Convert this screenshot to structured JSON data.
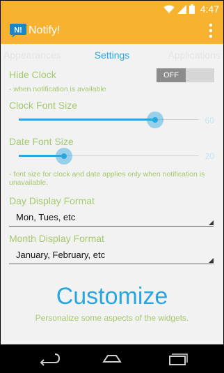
{
  "status_bar": {
    "time": "4:47",
    "wifi_icon": "wifi-icon",
    "signal_icon": "signal-icon",
    "battery_icon": "battery-icon"
  },
  "app_bar": {
    "logo_text": "N!",
    "title": "Notify!",
    "menu_icon": "overflow-menu-icon",
    "color": "#f7b230"
  },
  "tabs": {
    "previous": "Appearances",
    "current": "Settings",
    "next": "Applications"
  },
  "settings": {
    "hide_clock": {
      "label": "Hide Clock",
      "hint": "- when notification is available",
      "toggle": "OFF"
    },
    "clock_font_size": {
      "label": "Clock Font Size",
      "value": "60",
      "level": 0.76
    },
    "date_font_size": {
      "label": "Date Font Size",
      "value": "20",
      "level": 0.25
    },
    "font_note": "- font size for clock and date applies only when notification is unavailable.",
    "day_format": {
      "label": "Day Display Format",
      "value": "Mon, Tues, etc"
    },
    "month_format": {
      "label": "Month Display Format",
      "value": "January, February, etc"
    }
  },
  "page": {
    "title": "Customize",
    "subtitle": "Personalize some aspects of the widgets."
  },
  "nav_bar": {
    "back": "back-icon",
    "home": "home-icon",
    "recents": "recents-icon"
  },
  "colors": {
    "accent": "#2aa6df",
    "label_green": "#a5c96d",
    "background": "#f2f2f2"
  }
}
